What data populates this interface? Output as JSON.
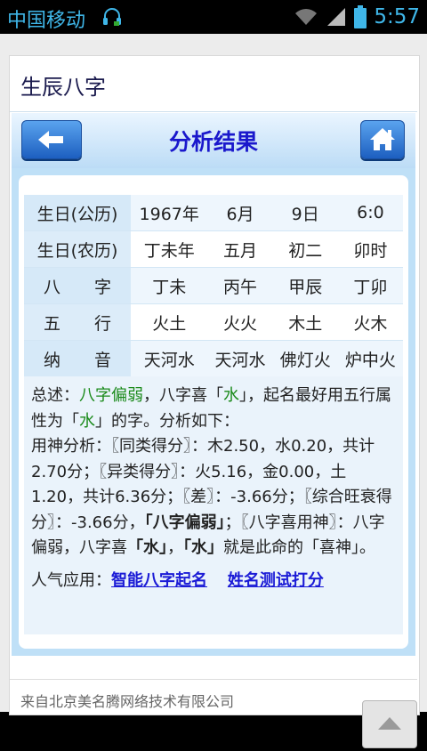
{
  "status_bar": {
    "carrier": "中国移动",
    "time": "5:57",
    "icons": [
      "headset-icon",
      "wifi-icon",
      "signal-icon",
      "battery-icon"
    ]
  },
  "site": {
    "title": "生辰八字"
  },
  "header": {
    "title": "分析结果",
    "back_icon": "arrow-left-icon",
    "home_icon": "home-icon"
  },
  "table": {
    "rows": [
      {
        "label_a": "生日(公历)",
        "label_b": "",
        "cells": [
          "1967年",
          "6月",
          "9日",
          "6:0"
        ]
      },
      {
        "label_a": "生日(农历)",
        "label_b": "",
        "cells": [
          "丁未年",
          "五月",
          "初二",
          "卯时"
        ]
      },
      {
        "label_a": "八",
        "label_b": "字",
        "cells": [
          "丁未",
          "丙午",
          "甲辰",
          "丁卯"
        ]
      },
      {
        "label_a": "五",
        "label_b": "行",
        "cells": [
          "火土",
          "火火",
          "木土",
          "火木"
        ]
      },
      {
        "label_a": "纳",
        "label_b": "音",
        "cells": [
          "天河水",
          "天河水",
          "佛灯火",
          "炉中火"
        ]
      }
    ]
  },
  "summary": {
    "s1": "总述：",
    "s2": "八字偏弱",
    "s3": "，八字喜「",
    "s4": "水",
    "s5": "」，起名最好用五行属性为「",
    "s6": "水",
    "s7": "」的字。分析如下：",
    "s8": "用神分析：〖同类得分〗：木2.50，水0.20，共计2.70分；〖异类得分〗：火5.16，金0.00，土1.20，共计6.36分；〖差〗：-3.66分；〖综合旺衰得分〗：-3.66分，",
    "s9": "「八字偏弱」",
    "s10": "；〖八字喜用神〗：八字偏弱，八字喜",
    "s11": "「水」",
    "s12": "，",
    "s13": "「水」",
    "s14": "就是此命的「喜神」。"
  },
  "popular": {
    "label": "人气应用：",
    "link1": "智能八字起名",
    "link2": "姓名测试打分"
  },
  "footer": {
    "text": "来自北京美名腾网络技术有限公司"
  },
  "colors": {
    "accent_blue": "#1a18cc",
    "link": "#1b1bd6",
    "green": "#1a8a1a",
    "button_blue": "#1d5fc0",
    "status_text": "#3fb6e8"
  }
}
